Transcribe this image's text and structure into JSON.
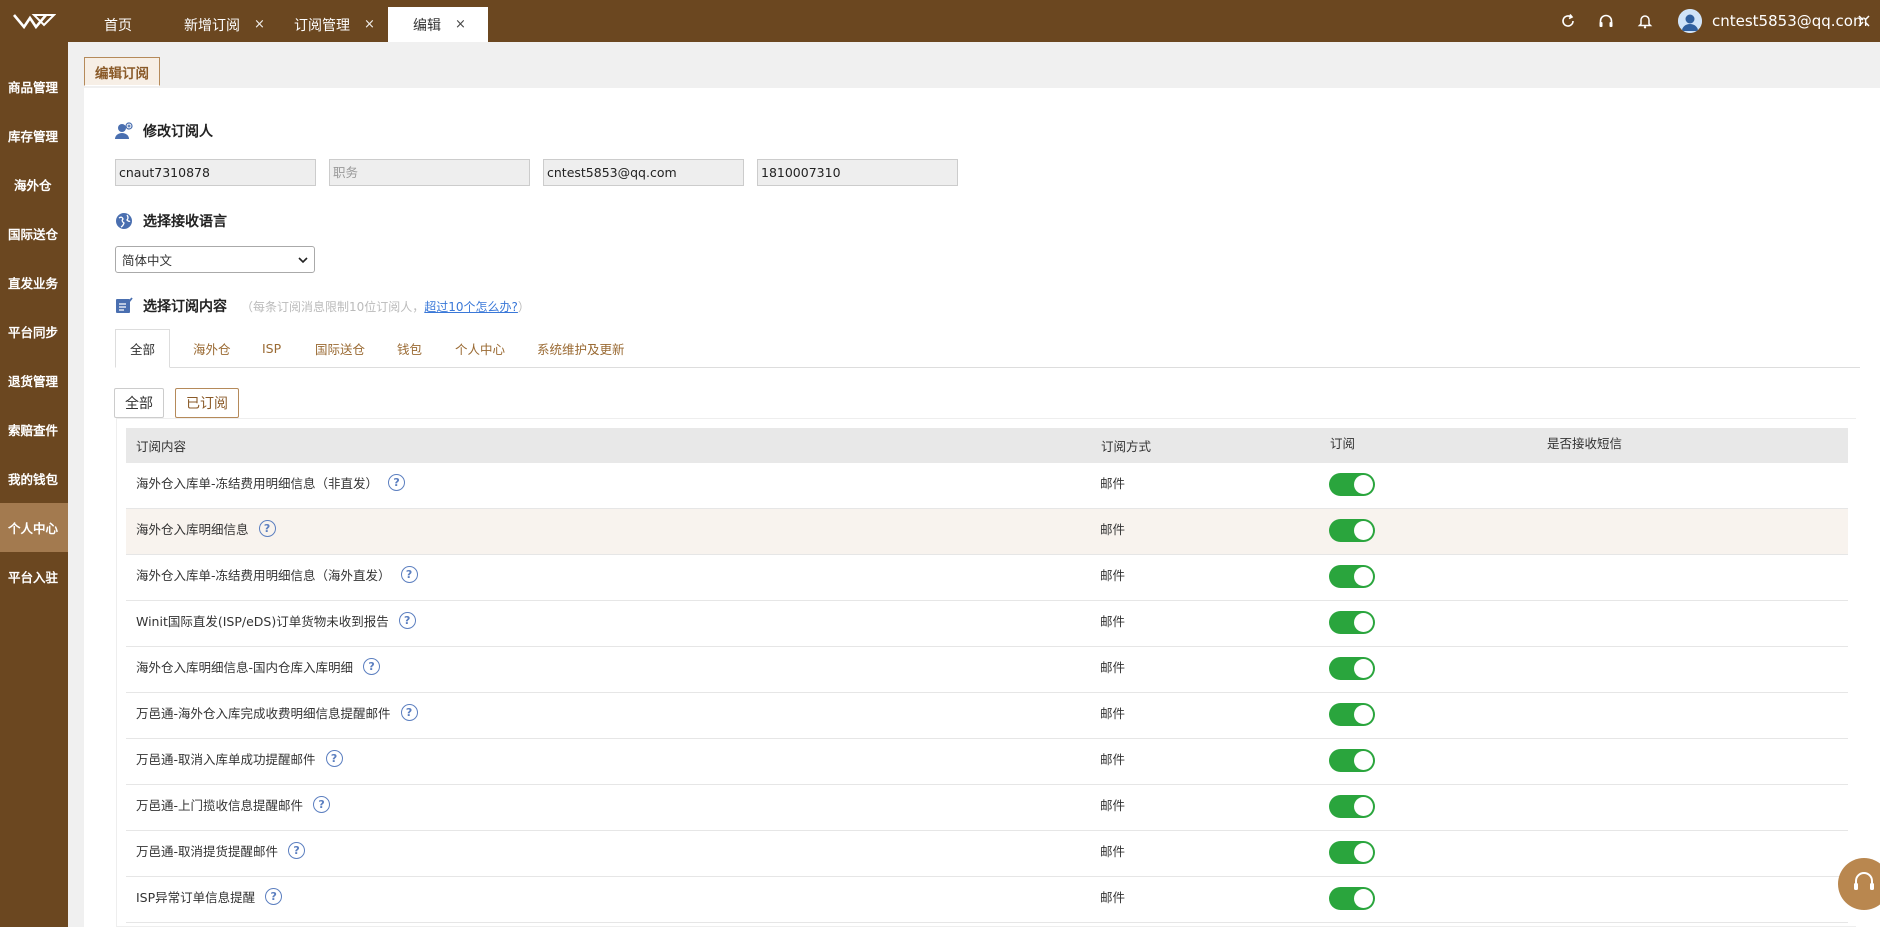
{
  "header": {
    "tabs": [
      {
        "label": "首页",
        "closable": false,
        "active": false
      },
      {
        "label": "新增订阅",
        "closable": true,
        "active": false
      },
      {
        "label": "订阅管理",
        "closable": true,
        "active": false
      },
      {
        "label": "编辑",
        "closable": true,
        "active": true
      }
    ],
    "close_glyph": "×",
    "icons": [
      "refresh-icon",
      "headset-icon",
      "bell-icon"
    ],
    "user_email": "cntest5853@qq.com"
  },
  "sidebar": {
    "items": [
      {
        "label": "商品管理"
      },
      {
        "label": "库存管理"
      },
      {
        "label": "海外仓"
      },
      {
        "label": "国际送仓"
      },
      {
        "label": "直发业务"
      },
      {
        "label": "平台同步"
      },
      {
        "label": "退货管理"
      },
      {
        "label": "索赔查件"
      },
      {
        "label": "我的钱包"
      },
      {
        "label": "个人中心",
        "active": true
      },
      {
        "label": "平台入驻"
      }
    ]
  },
  "page": {
    "tag": "编辑订阅",
    "section_subscriber": "修改订阅人",
    "fields": {
      "name_value": "cnaut7310878",
      "position_placeholder": "职务",
      "email_value": "cntest5853@qq.com",
      "phone_value": "1810007310"
    },
    "section_language": "选择接收语言",
    "language_selected": "简体中文",
    "section_content": "选择订阅内容",
    "hint_prefix": "（每条订阅消息限制10位订阅人，",
    "hint_link": "超过10个怎么办?",
    "hint_suffix": "）",
    "category_tabs": [
      "全部",
      "海外仓",
      "ISP",
      "国际送仓",
      "钱包",
      "个人中心",
      "系统维护及更新"
    ],
    "sub_tabs": [
      "全部",
      "已订阅"
    ],
    "help_glyph": "?"
  },
  "table": {
    "headers": [
      "订阅内容",
      "订阅方式",
      "订阅",
      "是否接收短信"
    ],
    "rows": [
      {
        "content": "海外仓入库单-冻结费用明细信息（非直发）",
        "method": "邮件",
        "subscribed": true
      },
      {
        "content": "海外仓入库明细信息",
        "method": "邮件",
        "subscribed": true
      },
      {
        "content": "海外仓入库单-冻结费用明细信息（海外直发）",
        "method": "邮件",
        "subscribed": true
      },
      {
        "content": "Winit国际直发(ISP/eDS)订单货物未收到报告",
        "method": "邮件",
        "subscribed": true
      },
      {
        "content": "海外仓入库明细信息-国内仓库入库明细",
        "method": "邮件",
        "subscribed": true
      },
      {
        "content": "万邑通-海外仓入库完成收费明细信息提醒邮件",
        "method": "邮件",
        "subscribed": true
      },
      {
        "content": "万邑通-取消入库单成功提醒邮件",
        "method": "邮件",
        "subscribed": true
      },
      {
        "content": "万邑通-上门揽收信息提醒邮件",
        "method": "邮件",
        "subscribed": true
      },
      {
        "content": "万邑通-取消提货提醒邮件",
        "method": "邮件",
        "subscribed": true
      },
      {
        "content": "ISP异常订单信息提醒",
        "method": "邮件",
        "subscribed": true
      }
    ]
  },
  "colors": {
    "brand": "#6b4720",
    "accent": "#b58a5a",
    "toggle_on": "#2aa53d"
  }
}
